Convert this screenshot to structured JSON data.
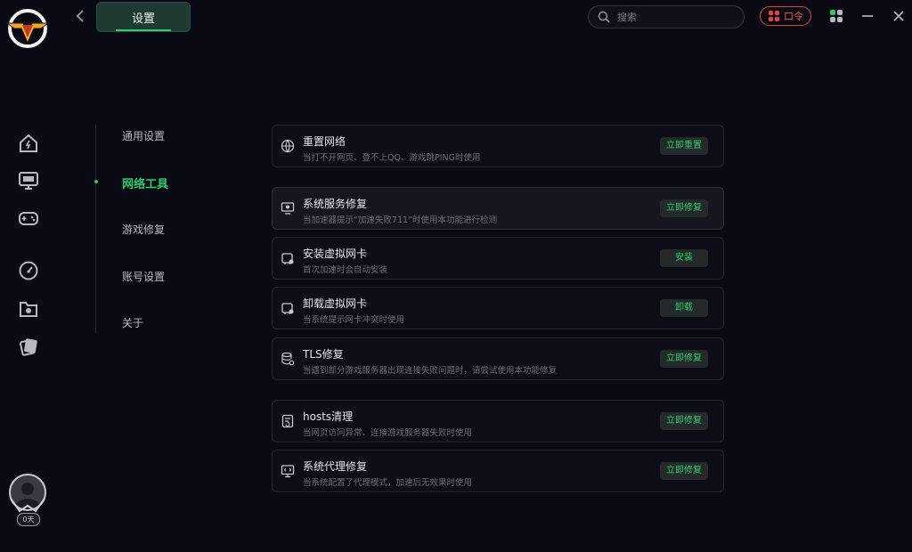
{
  "header": {
    "title_tab": "设置",
    "search_placeholder": "搜索",
    "kouling_label": "口令"
  },
  "sidebar": {
    "streak_label": "0天"
  },
  "menu": {
    "items": [
      {
        "label": "通用设置",
        "active": false
      },
      {
        "label": "网络工具",
        "active": true
      },
      {
        "label": "游戏修复",
        "active": false
      },
      {
        "label": "账号设置",
        "active": false
      },
      {
        "label": "关于",
        "active": false
      }
    ]
  },
  "tools": [
    {
      "title": "重置网络",
      "desc": "当打不开网页、登不上QQ、游戏跳PING时使用",
      "button": "立即重置"
    },
    {
      "title": "系统服务修复",
      "desc": "当加速器提示“加速失败711”时使用本功能进行检测",
      "button": "立即修复"
    },
    {
      "title": "安装虚拟网卡",
      "desc": "首次加速时会自动安装",
      "button": "安装"
    },
    {
      "title": "卸载虚拟网卡",
      "desc": "当系统提示网卡冲突时使用",
      "button": "卸载"
    },
    {
      "title": "TLS修复",
      "desc": "当遇到部分游戏服务器出现连接失败问题时，请尝试使用本功能修复",
      "button": "立即修复"
    },
    {
      "title": "hosts清理",
      "desc": "当网页访问异常、连接游戏服务器失败时使用",
      "button": "立即修复"
    },
    {
      "title": "系统代理修复",
      "desc": "当系统配置了代理模式，加速后无效果时使用",
      "button": "立即修复"
    }
  ],
  "colors": {
    "accent": "#2ecc71",
    "kouling": "#e0453c",
    "background": "#0a0a14"
  }
}
